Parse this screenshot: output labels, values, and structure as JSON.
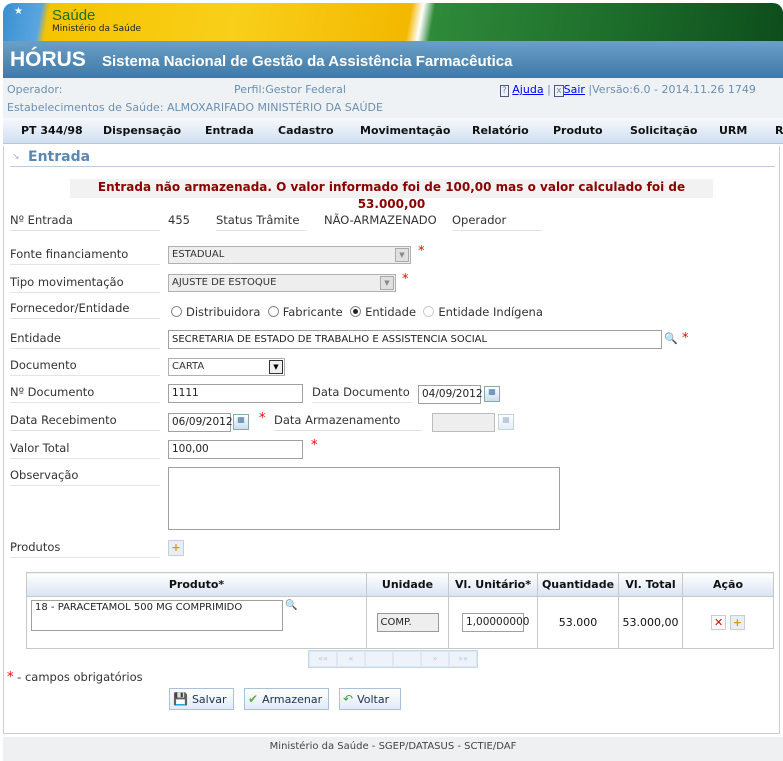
{
  "header": {
    "logo_title": "Saúde",
    "logo_subtitle": "Ministério da Saúde",
    "app_name": "HÓRUS",
    "app_subtitle": "Sistema Nacional de Gestão da Assistência Farmacêutica"
  },
  "info": {
    "operator": "Operador:",
    "profile": "Perfil:Gestor Federal",
    "help": "Ajuda",
    "sep": "|",
    "logout": "Sair",
    "version": "|Versão:6.0 - 2014.11.26 1749",
    "establishment": "Estabelecimentos de Saúde: ALMOXARIFADO MINISTÉRIO DA SAÚDE"
  },
  "menu": [
    "PT 344/98",
    "Dispensação",
    "Entrada",
    "Cadastro",
    "Movimentação",
    "Relatório",
    "Produto",
    "Solicitação",
    "URM",
    "Re"
  ],
  "page": {
    "title": "Entrada",
    "error": "Entrada não armazenada. O valor informado foi de 100,00 mas o valor calculado foi de 53.000,00"
  },
  "form": {
    "numero_label": "Nº Entrada",
    "numero": "455",
    "status_label": "Status Trâmite",
    "status": "NÃO-ARMAZENADO",
    "operador_label": "Operador",
    "fonte_label": "Fonte financiamento",
    "fonte": "ESTADUAL",
    "tipo_label": "Tipo movimentação",
    "tipo": "AJUSTE DE ESTOQUE",
    "fornecedor_label": "Fornecedor/Entidade",
    "radios": [
      "Distribuidora",
      "Fabricante",
      "Entidade",
      "Entidade Indígena"
    ],
    "radio_selected": "Entidade",
    "entidade_label": "Entidade",
    "entidade": "SECRETARIA DE ESTADO DE TRABALHO E ASSISTENCIA SOCIAL",
    "documento_label": "Documento",
    "documento": "CARTA",
    "num_doc_label": "Nº Documento",
    "num_doc": "1111",
    "data_doc_label": "Data Documento",
    "data_doc": "04/09/2012",
    "data_rec_label": "Data Recebimento",
    "data_rec": "06/09/2012",
    "data_arm_label": "Data Armazenamento",
    "data_arm": "",
    "valor_label": "Valor Total",
    "valor": "100,00",
    "obs_label": "Observação",
    "obs": "",
    "produtos_label": "Produtos",
    "required_mark": "*"
  },
  "table": {
    "headers": [
      "Produto*",
      "Unidade",
      "Vl. Unitário*",
      "Quantidade",
      "Vl. Total",
      "Ação"
    ],
    "rows": [
      {
        "produto": "18 - PARACETAMOL  500 MG  COMPRIMIDO",
        "unidade": "COMP.",
        "unitario": "1,00000000",
        "quantidade": "53.000",
        "total": "53.000,00"
      }
    ]
  },
  "pager": [
    "««",
    "«",
    "",
    "",
    "»",
    "»»"
  ],
  "legend": {
    "mark": "*",
    "text": " - campos obrigatórios"
  },
  "buttons": {
    "salvar": "Salvar",
    "armazenar": "Armazenar",
    "voltar": "Voltar"
  },
  "footer": "Ministério da Saúde - SGEP/DATASUS - SCTIE/DAF"
}
